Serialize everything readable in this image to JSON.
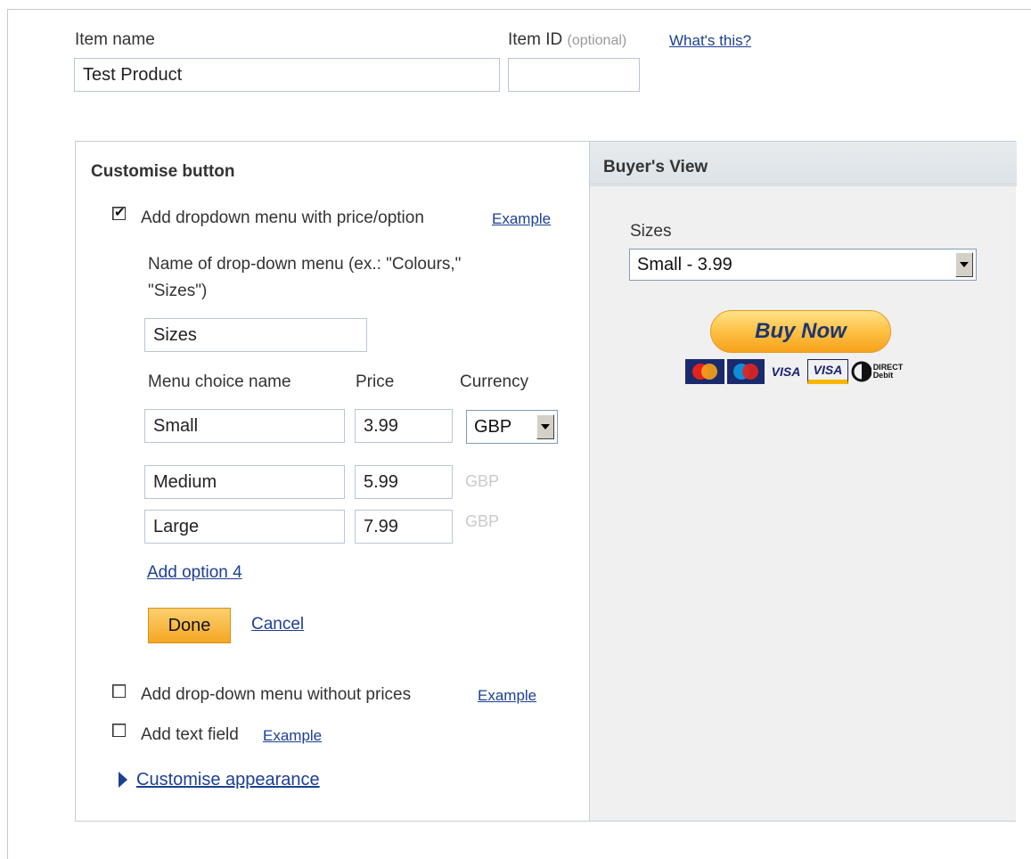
{
  "item": {
    "name_label": "Item name",
    "name_value": "Test Product",
    "id_label": "Item ID",
    "id_optional": "(optional)",
    "whats_this_link": "What's this?",
    "id_value": ""
  },
  "customise": {
    "title": "Customise button",
    "dropdown_price_label": "Add dropdown menu with price/option",
    "example_link": "Example",
    "menu_name_label_line1": "Name of drop-down menu (ex.: \"Colours,\"",
    "menu_name_label_line2": "\"Sizes\")",
    "menu_name_value": "Sizes",
    "col_choice": "Menu choice name",
    "col_price": "Price",
    "col_currency": "Currency",
    "options": [
      {
        "name": "Small",
        "price": "3.99",
        "currency": "GBP"
      },
      {
        "name": "Medium",
        "price": "5.99",
        "currency": "GBP"
      },
      {
        "name": "Large",
        "price": "7.99",
        "currency": "GBP"
      }
    ],
    "add_option_link": "Add option 4",
    "done_label": "Done",
    "cancel_label": "Cancel",
    "dropdown_no_price_label": "Add drop-down menu without prices",
    "text_field_label": "Add text field",
    "appearance_link": "Customise appearance",
    "dropdown_price_checked": true,
    "dropdown_no_price_checked": false,
    "text_field_checked": false
  },
  "buyer_view": {
    "title": "Buyer's View",
    "dropdown_label": "Sizes",
    "dropdown_selected": "Small - 3.99",
    "buy_now_label": "Buy Now",
    "cards": [
      "MasterCard",
      "Maestro",
      "VISA",
      "VISA",
      "DIRECT Debit"
    ]
  },
  "colors": {
    "link": "#1c3f94",
    "button_orange": "#f5a623",
    "panel_gray": "#f0f0f0"
  }
}
